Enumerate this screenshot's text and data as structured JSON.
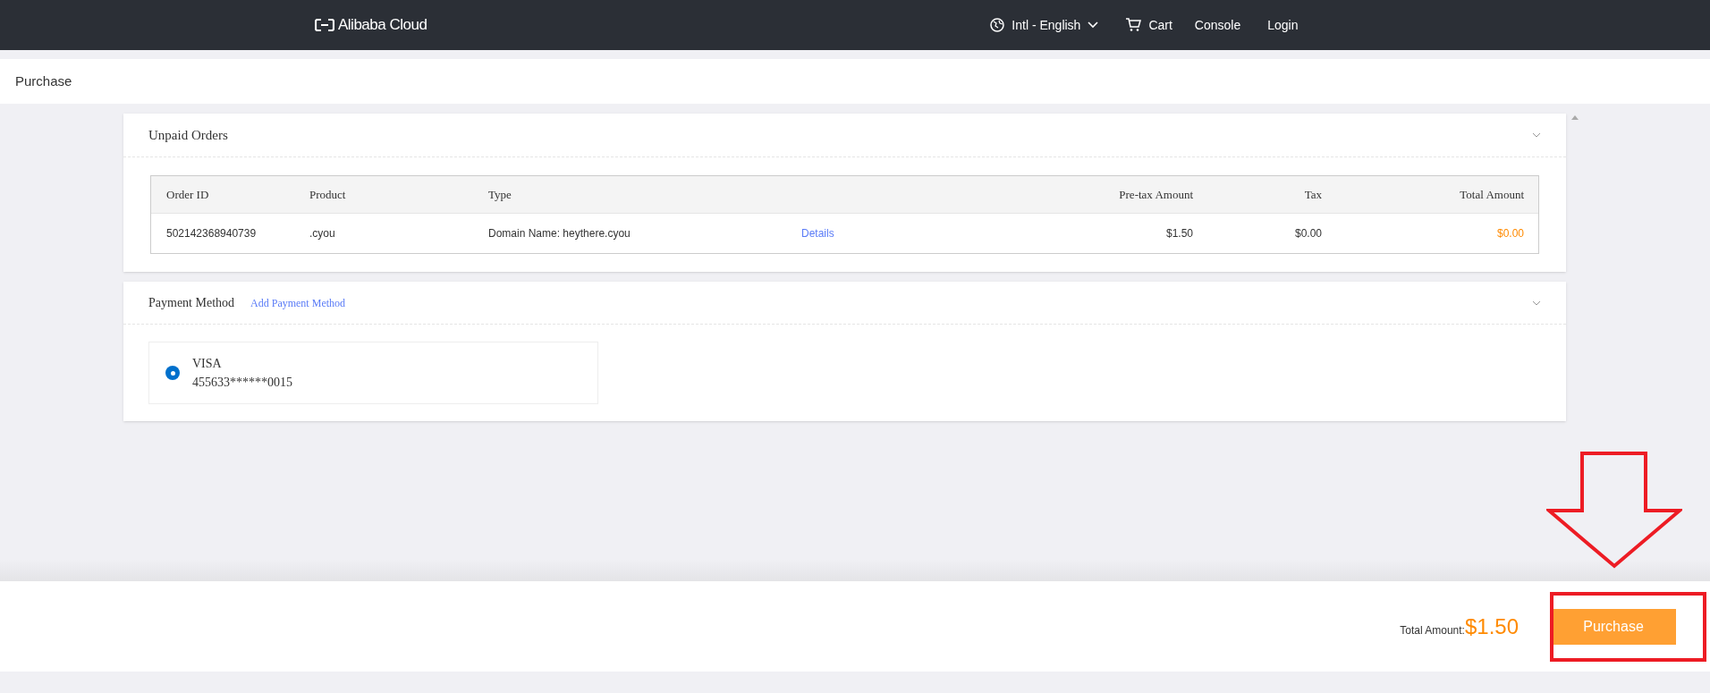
{
  "top_nav": {
    "logo": "Alibaba Cloud",
    "language": "Intl - English",
    "cart": "Cart",
    "links": [
      "Console",
      "Login"
    ]
  },
  "page_title": "Purchase",
  "unpaid_orders": {
    "title": "Unpaid Orders",
    "columns": [
      "Order ID",
      "Product",
      "Type",
      "Pre-tax Amount",
      "Tax",
      "Total Amount"
    ],
    "rows": [
      {
        "order_id": "502142368940739",
        "product": ".cyou",
        "type": "Domain Name: heythere.cyou",
        "details": "Details",
        "pretax": "$1.50",
        "tax": "$0.00",
        "total": "$0.00"
      }
    ]
  },
  "payment_method": {
    "title": "Payment Method",
    "add_link": "Add Payment Method",
    "methods": [
      {
        "brand": "VISA",
        "number": "455633******0015",
        "selected": true
      }
    ]
  },
  "footer": {
    "total_label": "Total Amount:",
    "total_value": "$1.50",
    "button": "Purchase"
  }
}
